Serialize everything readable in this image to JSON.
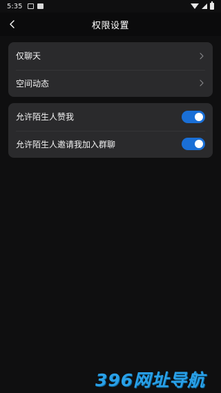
{
  "status_bar": {
    "time": "5:35",
    "icons": [
      "image-icon",
      "notification-icon",
      "wifi-icon",
      "signal-icon",
      "battery-icon"
    ]
  },
  "header": {
    "back_icon": "chevron-left-icon",
    "title": "权限设置"
  },
  "card_1": {
    "items": [
      {
        "label": "仅聊天",
        "icon": "chevron-right-icon"
      },
      {
        "label": "空间动态",
        "icon": "chevron-right-icon"
      }
    ]
  },
  "card_2": {
    "items": [
      {
        "label": "允许陌生人赞我",
        "toggle_on": true
      },
      {
        "label": "允许陌生人邀请我加入群聊",
        "toggle_on": true
      }
    ]
  },
  "colors": {
    "background": "#0f0f10",
    "card": "#2a2a2c",
    "toggle_on": "#1a6fd6",
    "watermark": "#2aa0e8"
  },
  "watermark": {
    "text": "396网址导航"
  }
}
